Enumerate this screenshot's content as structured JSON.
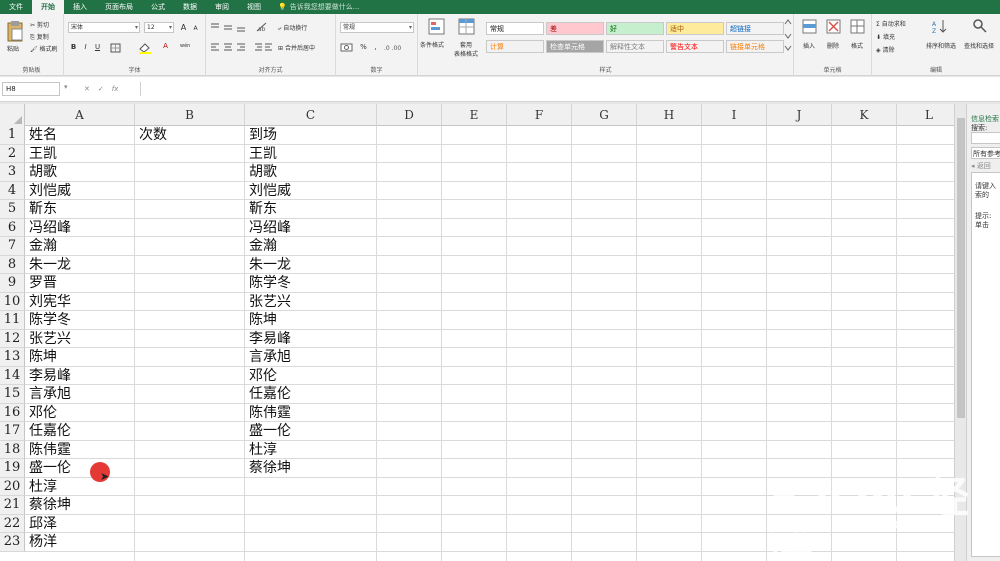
{
  "tabs": [
    "文件",
    "开始",
    "插入",
    "页面布局",
    "公式",
    "数据",
    "审阅",
    "视图"
  ],
  "active_tab": "开始",
  "tellme": "告诉我您想要做什么...",
  "ribbon": {
    "clipboard": {
      "paste": "粘贴",
      "cut": "剪切",
      "copy": "复制",
      "format_painter": "格式刷",
      "label": "剪贴板"
    },
    "font": {
      "name": "宋体",
      "size": "12",
      "label": "字体",
      "bold": "B",
      "italic": "I",
      "underline": "U",
      "grow": "A",
      "shrink": "A",
      "color_a": "A",
      "wen": "wén"
    },
    "alignment": {
      "wrap": "自动换行",
      "merge": "合并后居中",
      "label": "对齐方式"
    },
    "number": {
      "format": "常规",
      "percent": "%",
      "comma": ",",
      "label": "数字"
    },
    "styles": {
      "conditional": "条件格式",
      "table": "套用",
      "table2": "表格格式",
      "cells": [
        {
          "text": "常规",
          "bg": "#ffffff",
          "color": "#111111"
        },
        {
          "text": "差",
          "bg": "#ffc7ce",
          "color": "#9c0006"
        },
        {
          "text": "好",
          "bg": "#c6efce",
          "color": "#006100"
        },
        {
          "text": "适中",
          "bg": "#ffeb9c",
          "color": "#9c5700"
        },
        {
          "text": "超链接",
          "bg": "#f3f3f3",
          "color": "#0563c1"
        },
        {
          "text": "计算",
          "bg": "#f2f2f2",
          "color": "#fa7d00"
        },
        {
          "text": "检查单元格",
          "bg": "#a5a5a5",
          "color": "#ffffff"
        },
        {
          "text": "解释性文本",
          "bg": "#f3f3f3",
          "color": "#7f7f7f"
        },
        {
          "text": "警告文本",
          "bg": "#f3f3f3",
          "color": "#ff0000"
        },
        {
          "text": "链接单元格",
          "bg": "#f3f3f3",
          "color": "#fa7d00"
        }
      ],
      "label": "样式"
    },
    "cells_group": {
      "insert": "插入",
      "delete": "删除",
      "format": "格式",
      "label": "单元格"
    },
    "editing": {
      "autosum": "自动求和",
      "fill": "填充",
      "clear": "清除",
      "sort": "排序和筛选",
      "find": "查找和选择",
      "label": "编辑"
    }
  },
  "formula_bar": {
    "name_box": "H8",
    "cancel": "✕",
    "enter": "✓",
    "fx": "fx",
    "value": ""
  },
  "columns": [
    "A",
    "B",
    "C",
    "D",
    "E",
    "F",
    "G",
    "H",
    "I",
    "J",
    "K",
    "L"
  ],
  "rows": [
    1,
    2,
    3,
    4,
    5,
    6,
    7,
    8,
    9,
    10,
    11,
    12,
    13,
    14,
    15,
    16,
    17,
    18,
    19,
    20,
    21,
    22,
    23
  ],
  "sheet": {
    "A": [
      "姓名",
      "王凯",
      "胡歌",
      "刘恺威",
      "靳东",
      "冯绍峰",
      "金瀚",
      "朱一龙",
      "罗晋",
      "刘宪华",
      "陈学冬",
      "张艺兴",
      "陈坤",
      "李易峰",
      "言承旭",
      "邓伦",
      "任嘉伦",
      "陈伟霆",
      "盛一伦",
      "杜淳",
      "蔡徐坤",
      "邱泽",
      "杨洋"
    ],
    "B": [
      "次数"
    ],
    "C": [
      "到场",
      "王凯",
      "胡歌",
      "刘恺威",
      "靳东",
      "冯绍峰",
      "金瀚",
      "朱一龙",
      "陈学冬",
      "张艺兴",
      "陈坤",
      "李易峰",
      "言承旭",
      "邓伦",
      "任嘉伦",
      "陈伟霆",
      "盛一伦",
      "杜淳",
      "蔡徐坤"
    ]
  },
  "right_pane": {
    "title": "信息检索",
    "search_label": "搜索:",
    "scope": "所有参考",
    "back": "◂ 返回",
    "line1": "请键入",
    "line2": "索的",
    "line3": "提示:",
    "line4": "单击"
  },
  "watermark": {
    "logo": "Bai du 经验",
    "url": "jingyan.baidu.com"
  },
  "colors": {
    "accent": "#217346",
    "cursor": "#e53935"
  }
}
